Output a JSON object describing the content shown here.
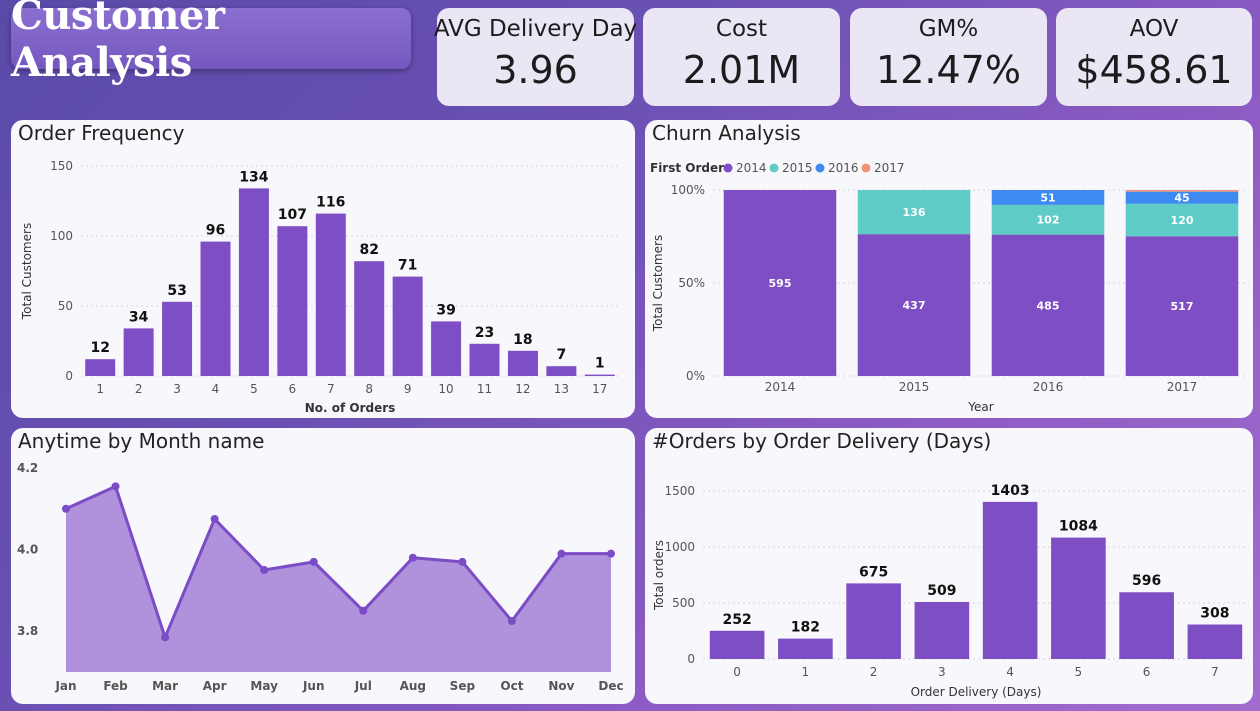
{
  "header": {
    "title": "Customer Analysis"
  },
  "kpis": [
    {
      "label": "AVG Delivery Day",
      "value": "3.96"
    },
    {
      "label": "Cost",
      "value": "2.01M"
    },
    {
      "label": "GM%",
      "value": "12.47%"
    },
    {
      "label": "AOV",
      "value": "$458.61"
    }
  ],
  "colors": {
    "bar": "#7e4ec4",
    "area": "#b091dc",
    "line": "#7a4cc6",
    "c2014": "#7e4ec4",
    "c2015": "#5ecbc6",
    "c2016": "#3d8bf0",
    "c2017": "#f3947a"
  },
  "chart_data": [
    {
      "type": "bar",
      "title": "Order Frequency",
      "xlabel": "No. of Orders",
      "ylabel": "Total Customers",
      "categories": [
        "1",
        "2",
        "3",
        "4",
        "5",
        "6",
        "7",
        "8",
        "9",
        "10",
        "11",
        "12",
        "13",
        "17"
      ],
      "values": [
        12,
        34,
        53,
        96,
        134,
        107,
        116,
        82,
        71,
        39,
        23,
        18,
        7,
        1
      ],
      "yticks": [
        "0",
        "50",
        "100",
        "150"
      ],
      "ylim": [
        0,
        150
      ],
      "grid": true
    },
    {
      "type": "bar",
      "stacked": "percent",
      "title": "Churn Analysis",
      "legend_title": "First Order",
      "legend_position": "top-left",
      "xlabel": "Year",
      "ylabel": "Total Customers",
      "categories": [
        "2014",
        "2015",
        "2016",
        "2017"
      ],
      "yticks": [
        "0%",
        "50%",
        "100%"
      ],
      "series": [
        {
          "name": "2014",
          "values": [
            595,
            437,
            485,
            517
          ],
          "labels": [
            "595",
            "437",
            "485",
            "517"
          ]
        },
        {
          "name": "2015",
          "values": [
            0,
            136,
            102,
            120
          ],
          "labels": [
            "",
            "136",
            "102",
            "120"
          ]
        },
        {
          "name": "2016",
          "values": [
            0,
            0,
            51,
            45
          ],
          "labels": [
            "",
            "",
            "51",
            "45"
          ]
        },
        {
          "name": "2017",
          "values": [
            0,
            0,
            0,
            6
          ],
          "labels": [
            "",
            "",
            "",
            ""
          ]
        }
      ]
    },
    {
      "type": "area",
      "title": "Anytime by Month name",
      "categories": [
        "Jan",
        "Feb",
        "Mar",
        "Apr",
        "May",
        "Jun",
        "Jul",
        "Aug",
        "Sep",
        "Oct",
        "Nov",
        "Dec"
      ],
      "values": [
        4.1,
        4.155,
        3.785,
        4.075,
        3.95,
        3.97,
        3.85,
        3.98,
        3.97,
        3.825,
        3.99,
        3.99
      ],
      "yticks": [
        "3.8",
        "4.0",
        "4.2"
      ],
      "ylim": [
        3.7,
        4.2
      ]
    },
    {
      "type": "bar",
      "title": "#Orders by Order Delivery (Days)",
      "xlabel": "Order Delivery (Days)",
      "ylabel": "Total orders",
      "categories": [
        "0",
        "1",
        "2",
        "3",
        "4",
        "5",
        "6",
        "7"
      ],
      "values": [
        252,
        182,
        675,
        509,
        1403,
        1084,
        596,
        308
      ],
      "yticks": [
        "0",
        "500",
        "1000",
        "1500"
      ],
      "ylim": [
        0,
        1500
      ],
      "grid": true
    }
  ]
}
